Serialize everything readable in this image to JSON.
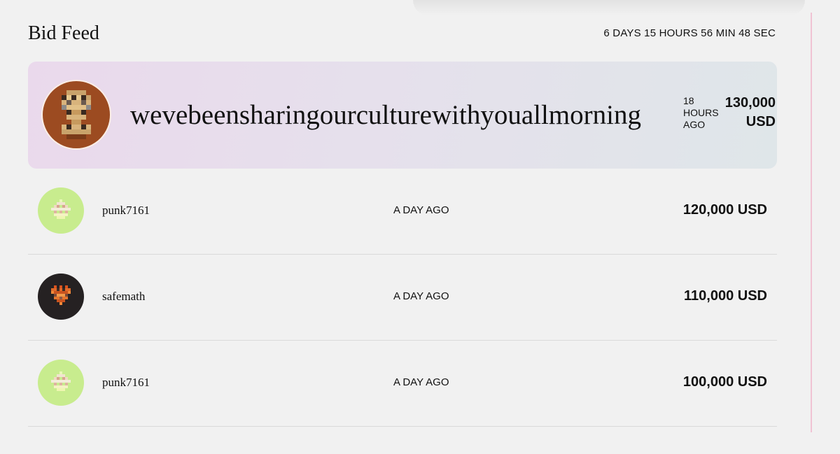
{
  "header": {
    "title": "Bid Feed",
    "countdown": "6 DAYS 15 HOURS 56 MIN 48 SEC"
  },
  "top_bid": {
    "bidder": "wevebeensharingourculturewithyouallmorning",
    "time": "18 HOURS AGO",
    "amount": "130,000 USD",
    "avatar_icon": "pixel-punk-avatar",
    "avatar_color": "#9c4b21"
  },
  "bids": [
    {
      "bidder": "punk7161",
      "time": "A DAY AGO",
      "amount": "120,000 USD",
      "avatar_icon": "pixel-punk-avatar",
      "avatar_color": "#c8ec8e"
    },
    {
      "bidder": "safemath",
      "time": "A DAY AGO",
      "amount": "110,000 USD",
      "avatar_icon": "pixel-punk-avatar",
      "avatar_color": "#252122"
    },
    {
      "bidder": "punk7161",
      "time": "A DAY AGO",
      "amount": "100,000 USD",
      "avatar_icon": "pixel-punk-avatar",
      "avatar_color": "#c8ec8e"
    }
  ],
  "colors": {
    "background": "#f1f1f1",
    "highlight_start": "#ead9ec",
    "highlight_end": "#dfe6e9",
    "accent_rule": "#f0c3d4"
  }
}
